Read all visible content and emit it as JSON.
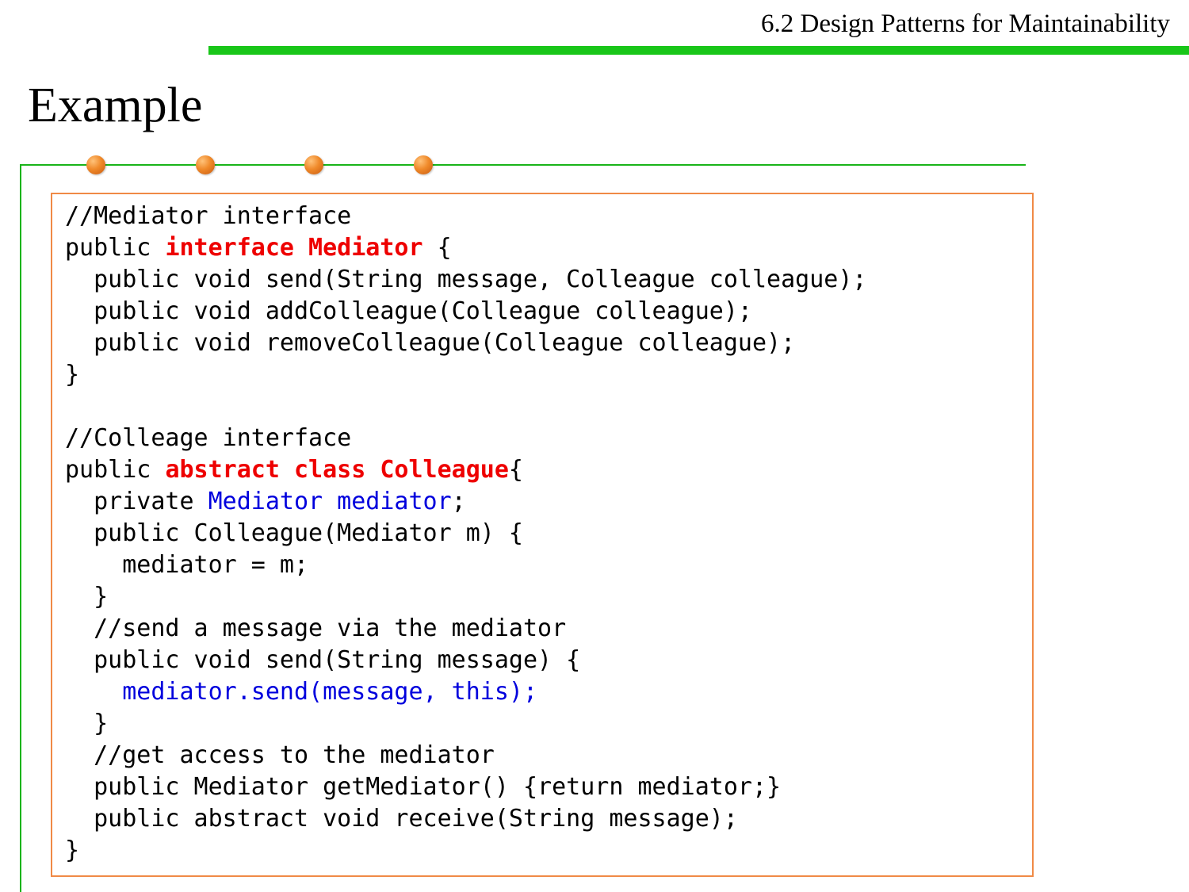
{
  "header": {
    "section_title": "6.2 Design Patterns for Maintainability"
  },
  "slide": {
    "title": "Example"
  },
  "colors": {
    "accent_green": "#19c619",
    "border_orange": "#f08a46",
    "keyword_red": "#ee0000",
    "highlight_blue": "#0000dd"
  },
  "code": {
    "lines": [
      [
        {
          "t": "//Mediator interface",
          "s": "plain"
        }
      ],
      [
        {
          "t": "public ",
          "s": "plain"
        },
        {
          "t": "interface Mediator",
          "s": "red"
        },
        {
          "t": " {",
          "s": "plain"
        }
      ],
      [
        {
          "t": "  public void send(String message, Colleague colleague);",
          "s": "plain"
        }
      ],
      [
        {
          "t": "  public void addColleague(Colleague colleague);",
          "s": "plain"
        }
      ],
      [
        {
          "t": "  public void removeColleague(Colleague colleague);",
          "s": "plain"
        }
      ],
      [
        {
          "t": "}",
          "s": "plain"
        }
      ],
      [
        {
          "t": "",
          "s": "plain"
        }
      ],
      [
        {
          "t": "//Colleage interface",
          "s": "plain"
        }
      ],
      [
        {
          "t": "public ",
          "s": "plain"
        },
        {
          "t": "abstract class Colleague",
          "s": "red"
        },
        {
          "t": "{",
          "s": "plain"
        }
      ],
      [
        {
          "t": "  private ",
          "s": "plain"
        },
        {
          "t": "Mediator mediator",
          "s": "blue"
        },
        {
          "t": ";",
          "s": "plain"
        }
      ],
      [
        {
          "t": "  public Colleague(Mediator m) {",
          "s": "plain"
        }
      ],
      [
        {
          "t": "    mediator = m;",
          "s": "plain"
        }
      ],
      [
        {
          "t": "  }",
          "s": "plain"
        }
      ],
      [
        {
          "t": "  //send a message via the mediator",
          "s": "plain"
        }
      ],
      [
        {
          "t": "  public void send(String message) {",
          "s": "plain"
        }
      ],
      [
        {
          "t": "    ",
          "s": "plain"
        },
        {
          "t": "mediator.send(message, this);",
          "s": "blue"
        }
      ],
      [
        {
          "t": "  }",
          "s": "plain"
        }
      ],
      [
        {
          "t": "  //get access to the mediator",
          "s": "plain"
        }
      ],
      [
        {
          "t": "  public Mediator getMediator() {return mediator;}",
          "s": "plain"
        }
      ],
      [
        {
          "t": "  public abstract void receive(String message);",
          "s": "plain"
        }
      ],
      [
        {
          "t": "}",
          "s": "plain"
        }
      ]
    ]
  }
}
